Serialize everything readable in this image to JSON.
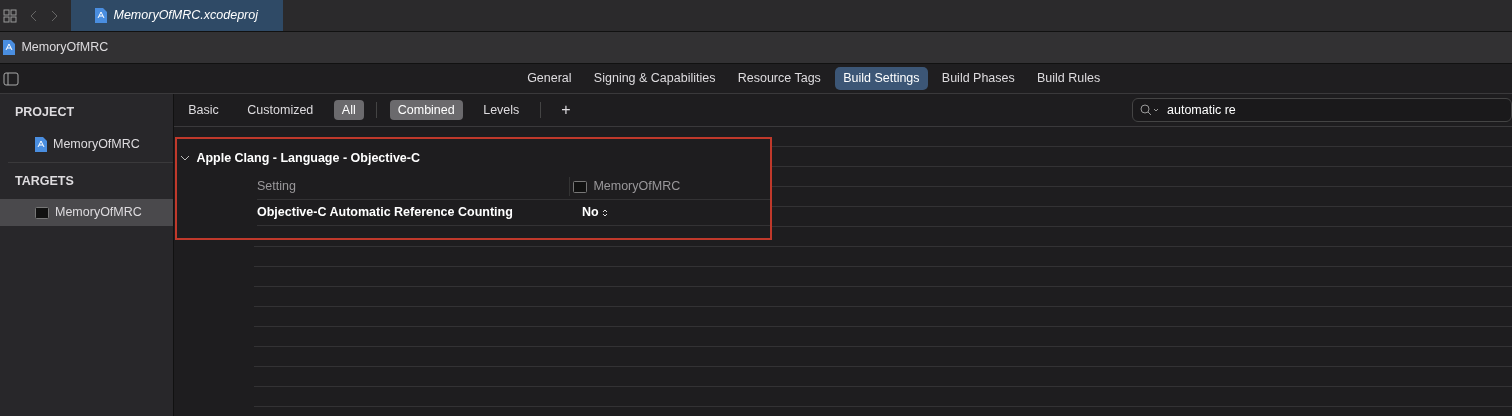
{
  "window_tabs": [
    {
      "title": "MemoryOfMRC.xcodeproj",
      "selected": true
    }
  ],
  "breadcrumb": "MemoryOfMRC",
  "editor_tabs": [
    {
      "label": "General",
      "selected": false
    },
    {
      "label": "Signing & Capabilities",
      "selected": false
    },
    {
      "label": "Resource Tags",
      "selected": false
    },
    {
      "label": "Build Settings",
      "selected": true
    },
    {
      "label": "Build Phases",
      "selected": false
    },
    {
      "label": "Build Rules",
      "selected": false
    }
  ],
  "sidebar": {
    "sections": [
      {
        "title": "PROJECT",
        "items": [
          {
            "label": "MemoryOfMRC",
            "kind": "project",
            "selected": false
          }
        ]
      },
      {
        "title": "TARGETS",
        "items": [
          {
            "label": "MemoryOfMRC",
            "kind": "target",
            "selected": true
          }
        ]
      }
    ]
  },
  "filter_bar": {
    "scope": [
      {
        "label": "Basic",
        "selected": false
      },
      {
        "label": "Customized",
        "selected": false
      },
      {
        "label": "All",
        "selected": true
      }
    ],
    "view": [
      {
        "label": "Combined",
        "selected": true
      },
      {
        "label": "Levels",
        "selected": false
      }
    ],
    "add": "+",
    "search": {
      "value": "automatic re"
    }
  },
  "settings_group": {
    "title": "Apple Clang - Language - Objective-C",
    "expanded": true,
    "header": {
      "setting": "Setting",
      "target": "MemoryOfMRC"
    },
    "rows": [
      {
        "name": "Objective-C Automatic Reference Counting",
        "value": "No"
      }
    ]
  }
}
